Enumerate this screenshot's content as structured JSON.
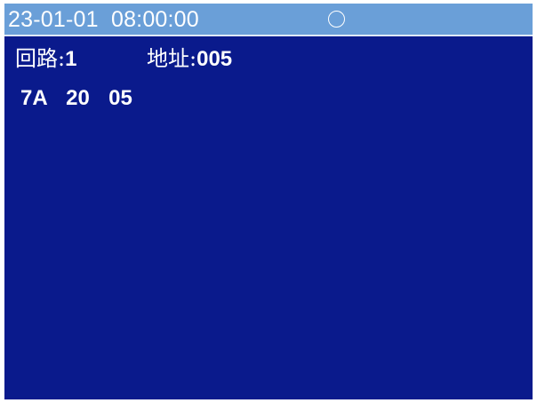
{
  "status_bar": {
    "datetime": "23-01-01  08:00:00",
    "status_icon": "circle-indicator-icon"
  },
  "info": {
    "loop_label": "回路:",
    "loop_value": "1",
    "address_label": "地址:",
    "address_value": "005"
  },
  "data": {
    "hex_bytes": "7A  20  05"
  },
  "colors": {
    "screen_background": "#0a1a8c",
    "status_bar_background": "#6a9fd8",
    "text": "#ffffff"
  }
}
